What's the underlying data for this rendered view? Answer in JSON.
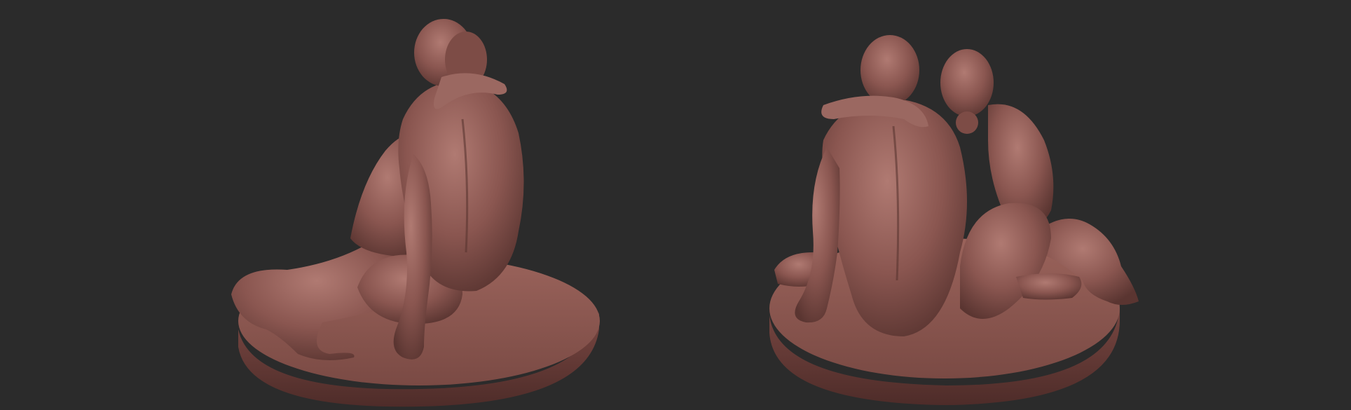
{
  "viewport": {
    "background": "#2b2b2b",
    "material_color": "#8a5650",
    "material_shadow": "#5a3531",
    "material_highlight": "#b07a72"
  },
  "renders": [
    {
      "id": "left",
      "description_icon": "sculpture-render-back-left-view"
    },
    {
      "id": "right",
      "description_icon": "sculpture-render-back-right-view"
    }
  ]
}
